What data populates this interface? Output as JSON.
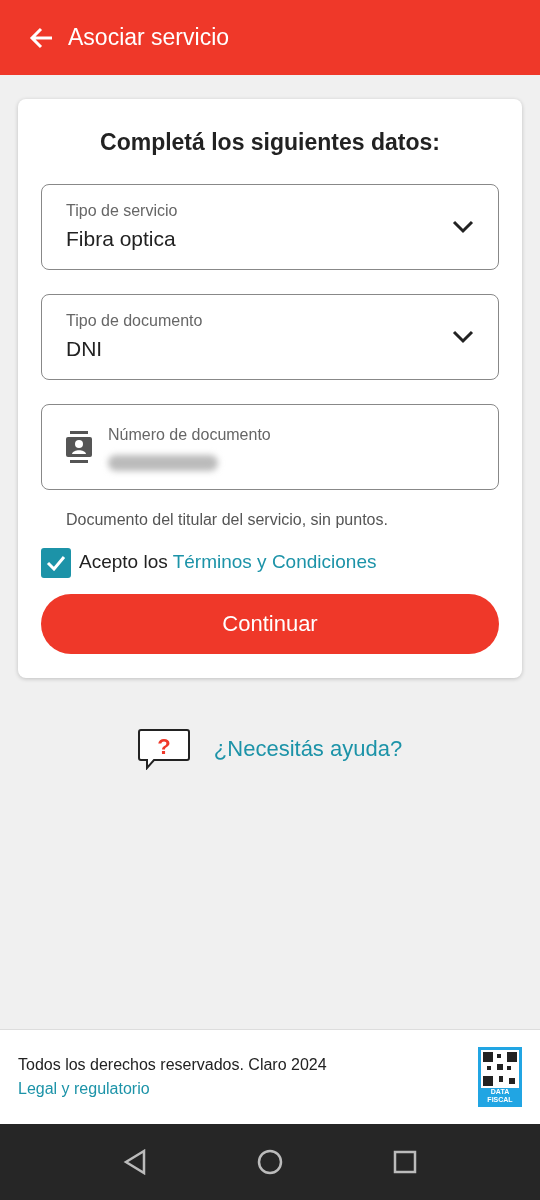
{
  "app_bar": {
    "title": "Asociar servicio"
  },
  "form": {
    "heading": "Completá los siguientes datos:",
    "fields": [
      {
        "kind": "select",
        "label": "Tipo de servicio",
        "value": "Fibra optica"
      },
      {
        "kind": "select",
        "label": "Tipo de documento",
        "value": "DNI"
      },
      {
        "kind": "redacted",
        "label": "Número de documento"
      }
    ],
    "hint": "Documento del titular del servicio, sin puntos.",
    "terms": {
      "checked": true,
      "text": "Acepto los",
      "link": "Términos y Condiciones"
    },
    "submit": "Continuar"
  },
  "help": {
    "mark": "?",
    "link": "¿Necesitás ayuda?"
  },
  "footer": {
    "copyright": "Todos los derechos reservados. Claro 2024",
    "link": "Legal y regulatorio",
    "badge_lines": [
      "DATA",
      "FISCAL"
    ]
  }
}
